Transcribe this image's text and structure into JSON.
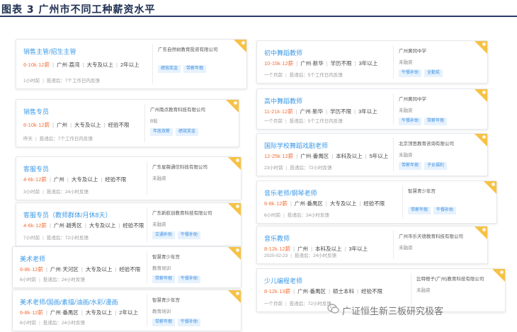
{
  "figure_title": "图表 3 广州市不同工种薪资水平",
  "watermark": "广证恒生新三板研究极客",
  "colors": {
    "title": "#3d9ae8",
    "salary": "#f2703a",
    "tag_bg": "#e6f2fd",
    "corner": "#f6c244",
    "header_rule": "#2a3a66"
  },
  "left_jobs": [
    {
      "title": "销售主管/招生主管",
      "salary": "6-10k·12薪",
      "location": "广州·荔湾",
      "education": "大专及以上",
      "experience": "2年以上",
      "posted": "1小时前",
      "feedback": "投递后：7个工作日内反馈",
      "company": "广东自然树教育投资有限公司",
      "funding": "",
      "tags": [
        "绩效奖金",
        "带薪年假"
      ]
    },
    {
      "title": "销售专员",
      "salary": "6-10k·12薪",
      "location": "广州",
      "education": "大专及以上",
      "experience": "经验不限",
      "posted": "昨天",
      "feedback": "投递后：7个工作日内反馈",
      "company": "广州南点教育科技有限公司",
      "funding": "B轮",
      "tags": [
        "年底双薪",
        "绩效奖金"
      ]
    },
    {
      "title": "客服专员",
      "salary": "4-6k·12薪",
      "location": "广州",
      "education": "大专及以上",
      "experience": "经验不限",
      "posted": "3小时前",
      "feedback": "投递后：24小时反馈",
      "company": "广东星薇通信科技有限公司",
      "funding": "未融资",
      "tags": []
    },
    {
      "title": "客服专员（教师群体/月休8天）",
      "salary": "4-6k·12薪",
      "location": "广州·越秀区",
      "education": "大专及以上",
      "experience": "经验不限",
      "posted": "7小时前",
      "feedback": "投递后：72小时反馈",
      "company": "广东新航创教育科技有限公司",
      "funding": "未融资",
      "tags": [
        "交通补助",
        "午餐补助"
      ]
    },
    {
      "title": "美术老师",
      "salary": "6-8k·12薪",
      "location": "广州·天河区",
      "education": "大专及以上",
      "experience": "经验不限",
      "posted": "6小时前",
      "feedback": "投递后：24小时反馈",
      "company": "智慧青少年宫",
      "funding": "教育培训",
      "tags": [
        "带薪年假",
        "午餐补助"
      ]
    },
    {
      "title": "美术老师/国画/素描/油画/水彩/漫画",
      "salary": "6-8k·12薪",
      "location": "广州·番禺区",
      "education": "大专及以上",
      "experience": "2年以上",
      "posted": "6小时前",
      "feedback": "投递后：24小时反馈",
      "company": "智慧青少年宫",
      "funding": "教育培训",
      "tags": [
        "带薪年假",
        "午餐补助"
      ]
    }
  ],
  "right_jobs": [
    {
      "title": "初中舞蹈教师",
      "salary": "10-15k·12薪",
      "location": "广州·新华",
      "education": "学历不限",
      "experience": "3年以上",
      "posted": "一个月前",
      "feedback": "投递后：5个工作日内反馈",
      "company": "广州黄冈中学",
      "funding": "未融资",
      "tags": [
        "午餐补助",
        "全勤奖"
      ]
    },
    {
      "title": "高中舞蹈教师",
      "salary": "11-21k·12薪",
      "location": "广州·新华",
      "education": "学历不限",
      "experience": "3年以上",
      "posted": "一个月前",
      "feedback": "投递后：5个工作日内反馈",
      "company": "广州黄冈中学",
      "funding": "未融资",
      "tags": [
        "午餐补助",
        "带薪年假"
      ]
    },
    {
      "title": "国际学校舞蹈戏剧老师",
      "salary": "12-25k·12薪",
      "location": "广州·番禺区",
      "education": "本科及以上",
      "experience": "5年以上",
      "posted": "23小时前",
      "feedback": "投递后：72小时反馈",
      "company": "北京顶思教育咨询有限公司",
      "funding": "未融资",
      "tags": [
        "带薪年假",
        "子女福利"
      ]
    },
    {
      "title": "音乐老师/钢琴老师",
      "salary": "6-8k·12薪",
      "location": "广州·番禺区",
      "education": "大专及以上",
      "experience": "经验不限",
      "posted": "6小时前",
      "feedback": "投递后：24小时反馈",
      "company": "智慧青少年宫",
      "funding": "",
      "tags": [
        "带薪年假",
        "午餐补助"
      ]
    },
    {
      "title": "音乐教师",
      "salary": "8-12k·12薪",
      "location": "广州",
      "education": "本科及以上",
      "experience": "3年以上",
      "posted": "2020-02-23",
      "feedback": "投递后：24小时反馈",
      "company": "广州市乐天德教育科技有限公司",
      "funding": "未融资",
      "tags": []
    },
    {
      "title": "少儿编程老师",
      "salary": "8-12k·13薪",
      "location": "广州·番禺区",
      "education": "硕士本科",
      "experience": "经验不限",
      "posted": "一个月前",
      "feedback": "投递后：72小时反馈",
      "company": "比特橙子(广州)教育科技有限公司",
      "funding": "未融资",
      "tags": []
    }
  ]
}
